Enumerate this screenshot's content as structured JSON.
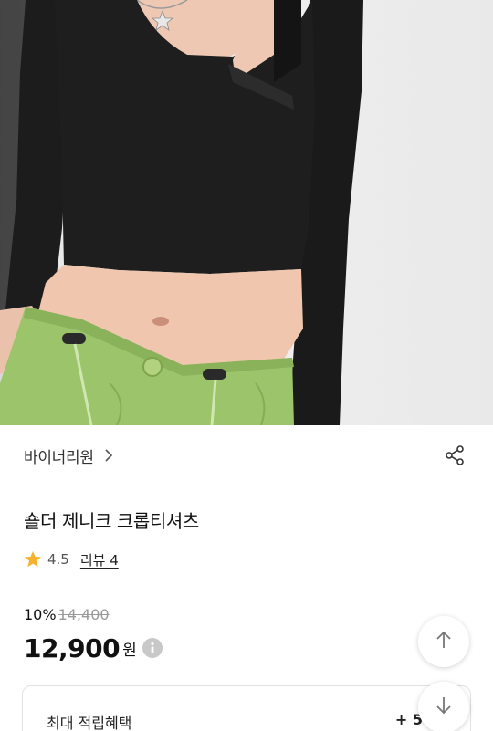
{
  "product": {
    "brand": "바이너리원",
    "title": "숄더 제니크 크롭티셔츠",
    "rating": "4.5",
    "review_link": "리뷰 4",
    "discount_rate": "10%",
    "original_price": "14,400",
    "sale_price": "12,900",
    "currency": "원"
  },
  "reward": {
    "label": "최대 적립혜택",
    "value": "+ 5"
  },
  "icons": {
    "brand_chevron": "chevron-right-icon",
    "share": "share-icon",
    "star": "star-icon",
    "info": "info-icon",
    "scroll_top": "arrow-up-icon",
    "scroll_down": "arrow-down-icon"
  },
  "colors": {
    "star": "#f4b22e",
    "shirt": "#1b1b1b",
    "skirt": "#9bc36a",
    "info_badge": "#c8c8c8"
  }
}
